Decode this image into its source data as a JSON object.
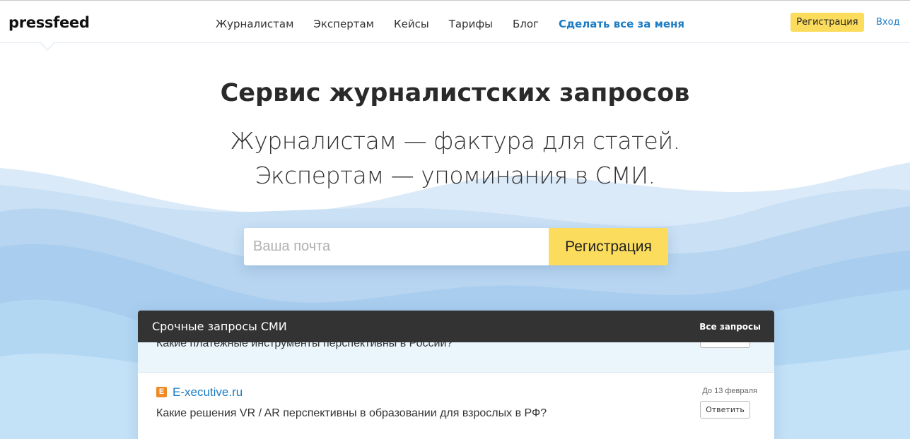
{
  "header": {
    "logo": "pressfeed",
    "nav": [
      "Журналистам",
      "Экспертам",
      "Кейсы",
      "Тарифы",
      "Блог"
    ],
    "nav_accent": "Сделать все за меня",
    "register": "Регистрация",
    "login": "Вход"
  },
  "hero": {
    "title": "Сервис журналистских запросов",
    "line1": "Журналистам — фактура для статей.",
    "line2": "Экспертам — упоминания в СМИ."
  },
  "form": {
    "email_placeholder": "Ваша почта",
    "email_value": "",
    "submit": "Регистрация"
  },
  "requests": {
    "title": "Срочные запросы СМИ",
    "all_link": "Все запросы",
    "items": [
      {
        "question": "Какие платежные инструменты перспективны в России?"
      },
      {
        "outlet_icon": "E",
        "outlet": "E-xecutive.ru",
        "deadline": "До 13 февраля",
        "question": "Какие решения VR / AR перспективны в образовании для взрослых в РФ?",
        "reply": "Ответить"
      }
    ]
  },
  "colors": {
    "accent_yellow": "#fbdc5c",
    "link_blue": "#1b7cc4",
    "panel_header": "#333333",
    "outlet_icon": "#f08a24"
  }
}
